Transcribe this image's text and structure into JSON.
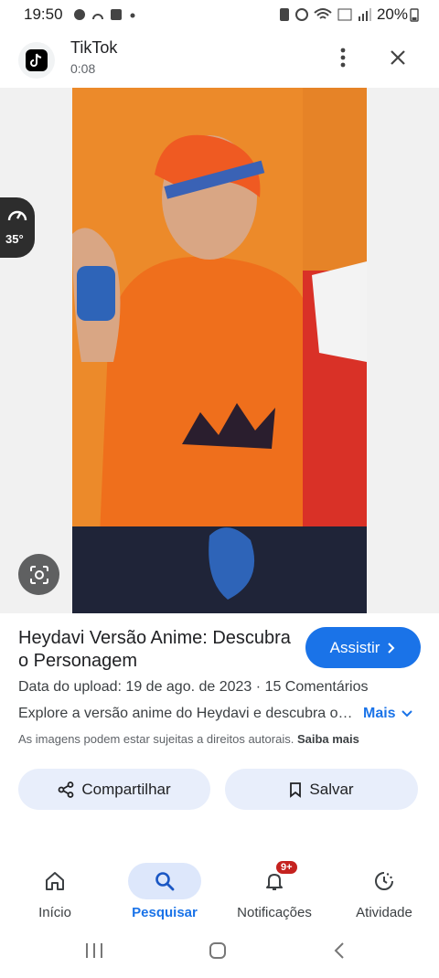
{
  "status_bar": {
    "time": "19:50",
    "battery": "20%"
  },
  "header": {
    "app_name": "TikTok",
    "duration": "0:08"
  },
  "media": {
    "speed_label": "35°"
  },
  "details": {
    "title": "Heydavi Versão Anime: Descubra o Personagem",
    "watch_label": "Assistir",
    "upload_text": "Data do upload: 19 de ago. de 2023",
    "comments_text": "15 Comentários",
    "description": "Explore a versão anime do Heydavi e descubra o personagem",
    "more_label": "Mais",
    "copyright_text": "As imagens podem estar sujeitas a direitos autorais.",
    "learn_more": "Saiba mais"
  },
  "actions": {
    "share_label": "Compartilhar",
    "save_label": "Salvar"
  },
  "bottom_nav": {
    "items": [
      {
        "label": "Início",
        "icon": "home-icon"
      },
      {
        "label": "Pesquisar",
        "icon": "search-icon",
        "active": true
      },
      {
        "label": "Notificações",
        "icon": "bell-icon",
        "badge": "9+"
      },
      {
        "label": "Atividade",
        "icon": "activity-icon"
      }
    ]
  },
  "colors": {
    "accent": "#1a73e8",
    "badge": "#c5221f",
    "photo_background": "#ec8a2a"
  }
}
